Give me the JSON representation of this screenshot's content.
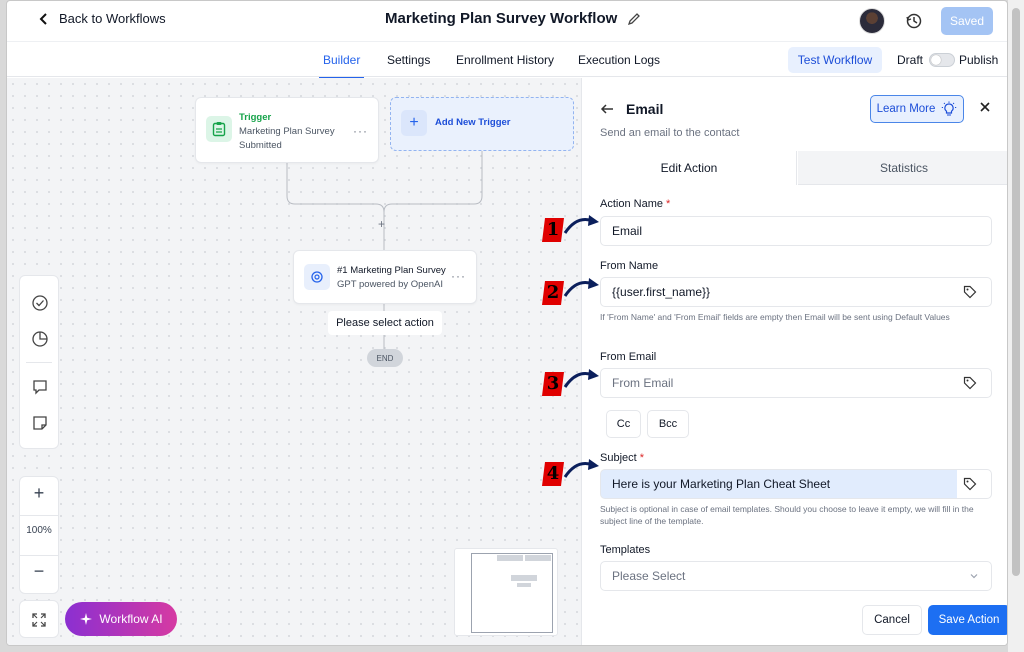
{
  "header": {
    "back_label": "Back to Workflows",
    "title": "Marketing Plan Survey Workflow",
    "saved_label": "Saved"
  },
  "nav": {
    "tabs": [
      {
        "label": "Builder",
        "active": true
      },
      {
        "label": "Settings"
      },
      {
        "label": "Enrollment History"
      },
      {
        "label": "Execution Logs"
      }
    ],
    "test_label": "Test Workflow",
    "draft_label": "Draft",
    "publish_label": "Publish"
  },
  "canvas": {
    "trigger": {
      "kind": "Trigger",
      "line1": "Marketing Plan Survey",
      "line2": "Submitted"
    },
    "add_trigger_label": "Add New Trigger",
    "gpt_node": {
      "line1": "#1 Marketing Plan Survey",
      "line2": "GPT powered by OpenAI"
    },
    "select_action_label": "Please select action",
    "end_label": "END",
    "zoom_level": "100%",
    "ai_label": "Workflow AI"
  },
  "panel": {
    "title": "Email",
    "subtitle": "Send an email to the contact",
    "learn_more_label": "Learn More",
    "tabs": [
      "Edit Action",
      "Statistics"
    ],
    "action_name_label": "Action Name",
    "action_name_value": "Email",
    "from_name_label": "From Name",
    "from_name_value": "{{user.first_name}}",
    "from_name_hint": "If 'From Name' and 'From Email' fields are empty then Email will be sent using Default Values",
    "from_email_label": "From Email",
    "from_email_placeholder": "From Email",
    "cc_label": "Cc",
    "bcc_label": "Bcc",
    "subject_label": "Subject",
    "subject_value": "Here is your Marketing Plan Cheat Sheet",
    "subject_hint": "Subject is optional in case of email templates. Should you choose to leave it empty, we will fill in the subject line of the template.",
    "templates_label": "Templates",
    "templates_placeholder": "Please Select",
    "cancel_label": "Cancel",
    "save_label": "Save Action"
  },
  "annotations": [
    "1",
    "2",
    "3",
    "4"
  ],
  "colors": {
    "accent": "#2563eb",
    "annotation_red": "#e00000",
    "ai_gradient": [
      "#8b2fd1",
      "#d63aa2"
    ]
  }
}
